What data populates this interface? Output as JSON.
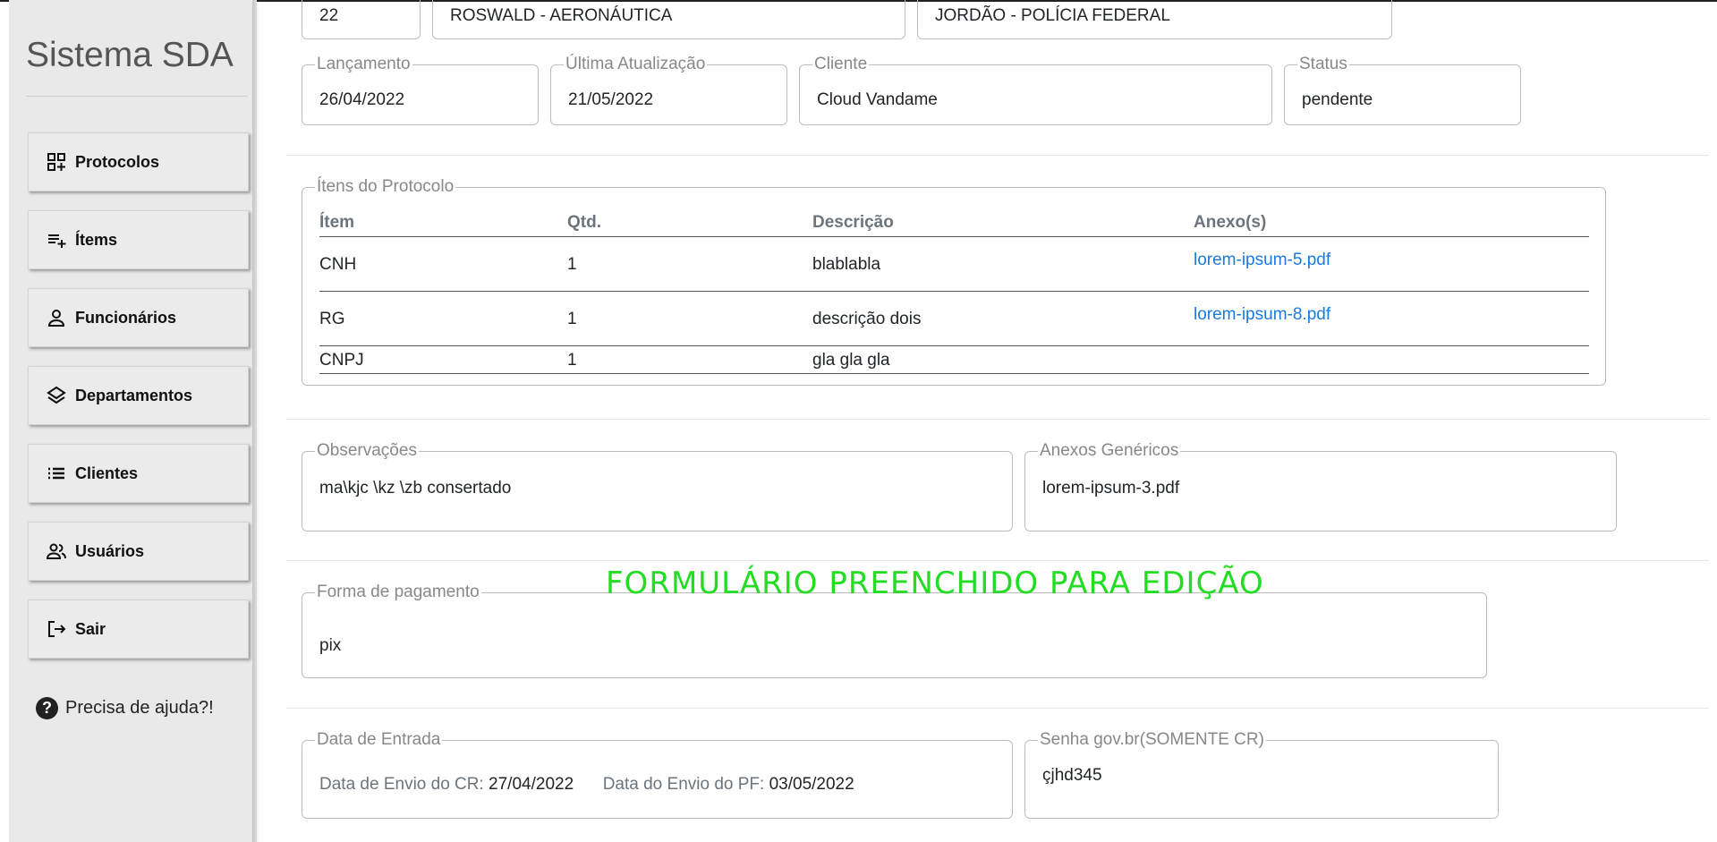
{
  "app": {
    "brand": "Sistema SDA"
  },
  "sidebar": {
    "items": [
      {
        "label": "Protocolos",
        "icon": "dashboard-add-icon"
      },
      {
        "label": "Ítems",
        "icon": "playlist-add-icon"
      },
      {
        "label": "Funcionários",
        "icon": "person-icon"
      },
      {
        "label": "Departamentos",
        "icon": "layers-icon"
      },
      {
        "label": "Clientes",
        "icon": "list-icon"
      },
      {
        "label": "Usuários",
        "icon": "people-icon"
      },
      {
        "label": "Sair",
        "icon": "logout-icon"
      }
    ],
    "help": "Precisa de ajuda?!"
  },
  "top_row": {
    "number": "22",
    "company": "ROSWALD - AERONÁUTICA",
    "contact": "JORDÃO - POLÍCIA FEDERAL"
  },
  "info": {
    "lancamento": {
      "label": "Lançamento",
      "value": "26/04/2022"
    },
    "atualizacao": {
      "label": "Última Atualização",
      "value": "21/05/2022"
    },
    "cliente": {
      "label": "Cliente",
      "value": "Cloud Vandame"
    },
    "status": {
      "label": "Status",
      "value": "pendente"
    }
  },
  "items_table": {
    "legend": "Ítens do Protocolo",
    "headers": [
      "Ítem",
      "Qtd.",
      "Descrição",
      "Anexo(s)"
    ],
    "rows": [
      {
        "item": "CNH",
        "qtd": "1",
        "descricao": "blablabla",
        "anexo": "lorem-ipsum-5.pdf"
      },
      {
        "item": "RG",
        "qtd": "1",
        "descricao": "descrição dois",
        "anexo": "lorem-ipsum-8.pdf"
      },
      {
        "item": "CNPJ",
        "qtd": "1",
        "descricao": "gla gla gla",
        "anexo": ""
      }
    ]
  },
  "observacoes": {
    "label": "Observações",
    "value": "ma\\kjc \\kz \\zb consertado"
  },
  "anexos_genericos": {
    "label": "Anexos Genéricos",
    "file": "lorem-ipsum-3.pdf"
  },
  "overlay": {
    "text": "FORMULÁRIO PREENCHIDO PARA EDIÇÃO",
    "color": "#22dd22"
  },
  "pagamento": {
    "label": "Forma de pagamento",
    "value": "pix"
  },
  "data_entrada": {
    "label": "Data de Entrada",
    "envio_cr_label": "Data de Envio do CR:",
    "envio_cr_value": "27/04/2022",
    "envio_pf_label": "Data do Envio do PF:",
    "envio_pf_value": "03/05/2022"
  },
  "senha": {
    "label": "Senha gov.br(SOMENTE CR)",
    "value": "çjhd345"
  },
  "colors": {
    "link": "#1a7ae0",
    "sidebar_bg": "#e9e9ea"
  }
}
